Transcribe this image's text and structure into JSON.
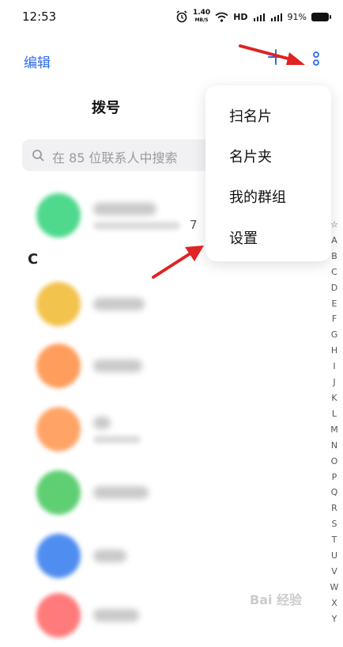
{
  "status_bar": {
    "time": "12:53",
    "speed_value": "1.40",
    "speed_unit": "MB/S",
    "hd": "HD",
    "sim1": "4G",
    "sim2": "4G",
    "battery": "91%"
  },
  "header": {
    "edit_label": "编辑",
    "title": "拨号"
  },
  "search": {
    "placeholder": "在 85 位联系人中搜索"
  },
  "contacts": {
    "row_digit": "7",
    "section_letter": "C",
    "avatar_colors": [
      "#4fd98d",
      "#f2c34d",
      "#ff9d5c",
      "#ffa466",
      "#5fcf74",
      "#4f8ef0",
      "#ff7b7b"
    ]
  },
  "index_bar": {
    "letters": [
      "☆",
      "A",
      "B",
      "C",
      "D",
      "E",
      "F",
      "G",
      "H",
      "I",
      "J",
      "K",
      "L",
      "M",
      "N",
      "O",
      "P",
      "Q",
      "R",
      "S",
      "T",
      "U",
      "V",
      "W",
      "X",
      "Y"
    ]
  },
  "menu": {
    "items": [
      "扫名片",
      "名片夹",
      "我的群组",
      "设置"
    ]
  },
  "colors": {
    "accent": "#2f6be8",
    "arrow": "#e02323"
  },
  "watermark": "Bai 经验"
}
